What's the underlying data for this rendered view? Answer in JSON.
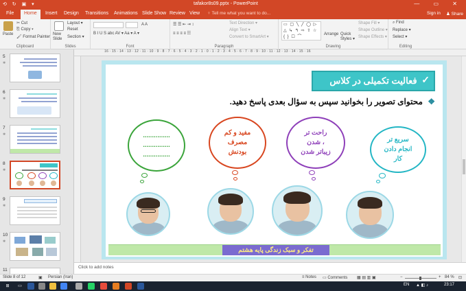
{
  "titlebar": {
    "document_title": "tafakor8s09.pptx - PowerPoint",
    "quick_access": "⟲ ↻ ▣ ▾",
    "window_controls": "— ▭ ✕"
  },
  "tabs": [
    {
      "label": "File",
      "active": false
    },
    {
      "label": "Home",
      "active": true
    },
    {
      "label": "Insert",
      "active": false
    },
    {
      "label": "Design",
      "active": false
    },
    {
      "label": "Transitions",
      "active": false
    },
    {
      "label": "Animations",
      "active": false
    },
    {
      "label": "Slide Show",
      "active": false
    },
    {
      "label": "Review",
      "active": false
    },
    {
      "label": "View",
      "active": false
    }
  ],
  "tell_me": "♀ Tell me what you want to do...",
  "sign_in": "Sign in",
  "share": "♟ Share",
  "ribbon": {
    "clipboard": {
      "paste": "Paste",
      "cut": "✂ Cut",
      "copy": "⎘ Copy ▾",
      "format_painter": "🖌 Format Painter",
      "label": "Clipboard"
    },
    "slides": {
      "new_slide": "New Slide",
      "layout": "Layout ▾",
      "reset": "Reset",
      "section": "Section ▾",
      "label": "Slides"
    },
    "font": {
      "label": "Font",
      "format_row": "B I U S abc AV ▾ Aa ▾ A ▾"
    },
    "paragraph": {
      "label": "Paragraph",
      "text_direction": "Text Direction ▾",
      "align_text": "Align Text ▾",
      "smartart": "Convert to SmartArt ▾"
    },
    "drawing": {
      "label": "Drawing",
      "arrange": "Arrange",
      "quick_styles": "Quick Styles ▾",
      "shape_fill": "Shape Fill ▾",
      "shape_outline": "Shape Outline ▾",
      "shape_effects": "Shape Effects ▾",
      "shapes_gallery": "▭ ▢ ╲ ╱ ◯ ▷ △ ↳ ↰ ⇨ ⇧ ☆ { } ☐ ⌒"
    },
    "editing": {
      "label": "Editing",
      "find": "⌕ Find",
      "replace": "Replace ▾",
      "select": "Select ▾"
    }
  },
  "ruler_marks": "16 · 15 · 14 · 13 · 12 · 11 · 10 · 9 · 8 · 7 · 6 · 5 · 4 · 3 · 2 · 1 · 0 · 1 · 2 · 3 · 4 · 5 · 6 · 7 · 8 · 9 · 10 · 11 · 12 · 13 · 14 · 15 · 16",
  "thumbnails": [
    {
      "number": "5",
      "selected": false
    },
    {
      "number": "6",
      "selected": false
    },
    {
      "number": "7",
      "selected": false
    },
    {
      "number": "8",
      "selected": true
    },
    {
      "number": "9",
      "selected": false
    },
    {
      "number": "10",
      "selected": false
    },
    {
      "number": "11",
      "selected": false
    }
  ],
  "slide": {
    "title": "فعالیت تکمیلی در کلاس",
    "title_check": "✓",
    "question": "محتوای تصویر را بخوانید سپس به سؤال بعدی پاسخ دهید.",
    "bullet": "❖",
    "bubbles": [
      {
        "text_lines": [
          "سریع تر",
          "انجام دادن",
          "کار"
        ],
        "color": "#23b6c4"
      },
      {
        "text_lines": [
          "راحت تر",
          "شدن ،",
          "زیباتر شدن"
        ],
        "color": "#8e3fb9"
      },
      {
        "text_lines": [
          "مفید و کم",
          "مصرف",
          "بودنش"
        ],
        "color": "#d8461f"
      },
      {
        "text_lines": [
          "...............",
          "...............",
          "..............."
        ],
        "color": "#3aa43a"
      }
    ],
    "footer": "تفکر و سبک زندگی پایه هشتم"
  },
  "notes_placeholder": "Click to add notes",
  "status": {
    "slide_info": "Slide 8 of 12",
    "language": "Persian (Iran)",
    "notes": "≡ Notes",
    "comments": "▭ Comments",
    "zoom": "84 %"
  },
  "taskbar": {
    "language": "EN",
    "time": "23:17"
  }
}
